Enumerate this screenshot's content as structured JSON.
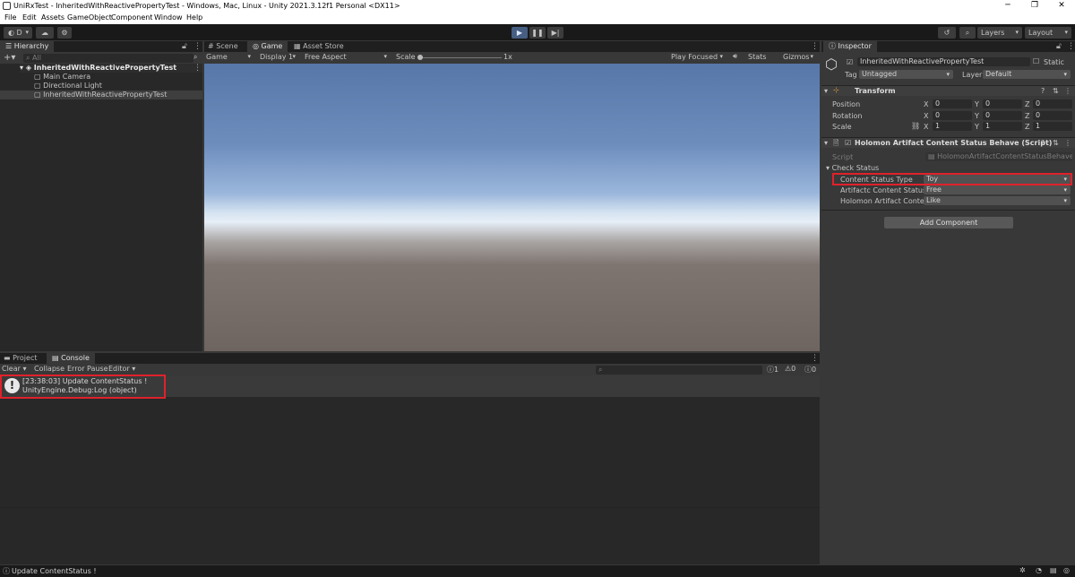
{
  "window": {
    "title": "UniRxTest - InheritedWithReactivePropertyTest - Windows, Mac, Linux - Unity 2021.3.12f1 Personal <DX11>",
    "minimize": "─",
    "maximize": "❐",
    "close": "✕"
  },
  "menu": [
    "File",
    "Edit",
    "Assets",
    "GameObject",
    "Component",
    "Window",
    "Help"
  ],
  "toolbar": {
    "account": "D",
    "layers": "Layers",
    "layout": "Layout"
  },
  "hierarchy": {
    "tab": "Hierarchy",
    "search_placeholder": "All",
    "scene": "InheritedWithReactivePropertyTest",
    "items": [
      "Main Camera",
      "Directional Light",
      "InheritedWithReactivePropertyTest"
    ]
  },
  "center_tabs": [
    "Scene",
    "Game",
    "Asset Store"
  ],
  "game_bar": {
    "mode": "Game",
    "display": "Display 1",
    "aspect": "Free Aspect",
    "scale_label": "Scale",
    "scale_value": "1x",
    "play_focused": "Play Focused",
    "stats": "Stats",
    "gizmos": "Gizmos"
  },
  "inspector": {
    "tab": "Inspector",
    "object_name": "InheritedWithReactivePropertyTest",
    "static_label": "Static",
    "tag_label": "Tag",
    "tag_value": "Untagged",
    "layer_label": "Layer",
    "layer_value": "Default",
    "transform": {
      "title": "Transform",
      "rows": [
        {
          "label": "Position",
          "x": "0",
          "y": "0",
          "z": "0"
        },
        {
          "label": "Rotation",
          "x": "0",
          "y": "0",
          "z": "0"
        },
        {
          "label": "Scale",
          "x": "1",
          "y": "1",
          "z": "1"
        }
      ]
    },
    "script_component": {
      "title": "Holomon Artifact Content Status Behave (Script)",
      "script_label": "Script",
      "script_value": "HolomonArtifactContentStatusBehave",
      "group": "Check Status",
      "fields": [
        {
          "label": "Content Status Type",
          "value": "Toy"
        },
        {
          "label": "Artifactc Content Status T",
          "value": "Free"
        },
        {
          "label": "Holomon Artifact Content !",
          "value": "Like"
        }
      ]
    },
    "add_component": "Add Component"
  },
  "bottom": {
    "tabs": [
      "Project",
      "Console"
    ],
    "console_bar": [
      "Clear",
      "Collapse",
      "Error Pause",
      "Editor"
    ],
    "counts": {
      "log": "1",
      "warn": "0",
      "error": "0"
    },
    "entries": [
      {
        "line1": "[23:38:03] Update ContentStatus !",
        "line2": "UnityEngine.Debug:Log (object)"
      }
    ]
  },
  "status_bar": {
    "message": "Update ContentStatus !"
  },
  "colors": {
    "highlight": "#e0212b",
    "play_active": "#465e82"
  }
}
